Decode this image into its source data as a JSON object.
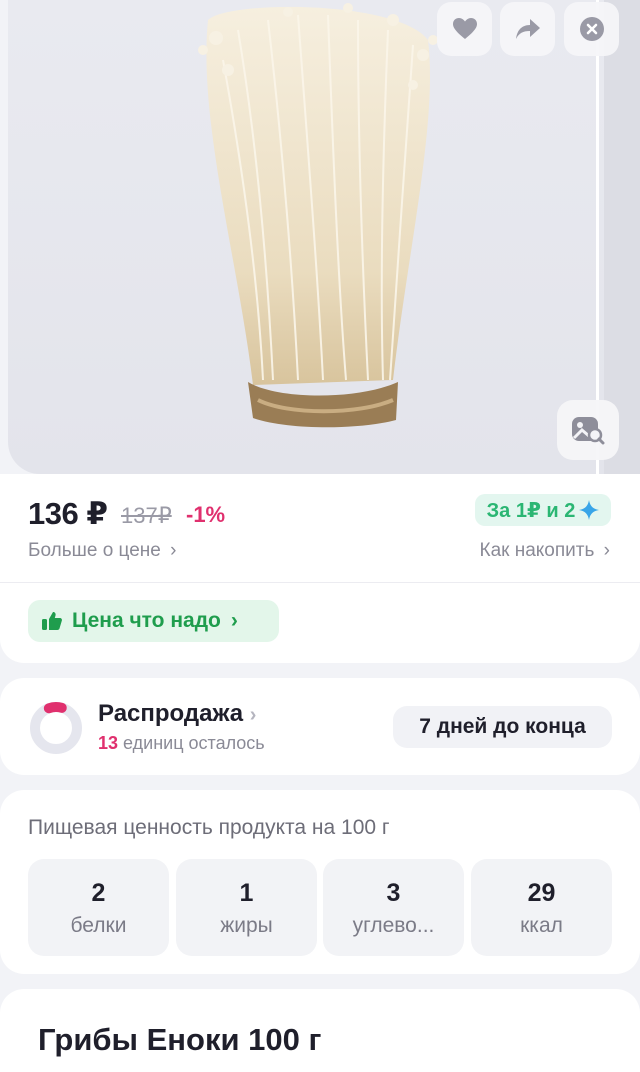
{
  "product_image_alt": "Грибы Еноки",
  "price": {
    "current": "136 ₽",
    "old": "137₽",
    "discount": "-1%",
    "bonus_text": "За 1₽ и 2",
    "more_about_price": "Больше о цене",
    "how_to_earn": "Как накопить",
    "good_price_chip": "Цена что надо"
  },
  "sale": {
    "title": "Распродажа",
    "remaining_count": "13",
    "remaining_text": "единиц осталось",
    "days_left": "7 дней до конца",
    "remaining_fraction": 0.1
  },
  "nutrition": {
    "title": "Пищевая ценность продукта на 100 г",
    "items": [
      {
        "value": "2",
        "label": "белки"
      },
      {
        "value": "1",
        "label": "жиры"
      },
      {
        "value": "3",
        "label": "углево..."
      },
      {
        "value": "29",
        "label": "ккал"
      }
    ]
  },
  "product_title": "Грибы Еноки 100 г",
  "colors": {
    "accent_pink": "#e0306e",
    "green": "#2bb673",
    "text": "#1f1f2b"
  },
  "icons": [
    "heart-icon",
    "share-icon",
    "close-icon",
    "image-search-icon",
    "thumbs-up-icon",
    "chevron-right-icon",
    "sparkle-icon"
  ]
}
